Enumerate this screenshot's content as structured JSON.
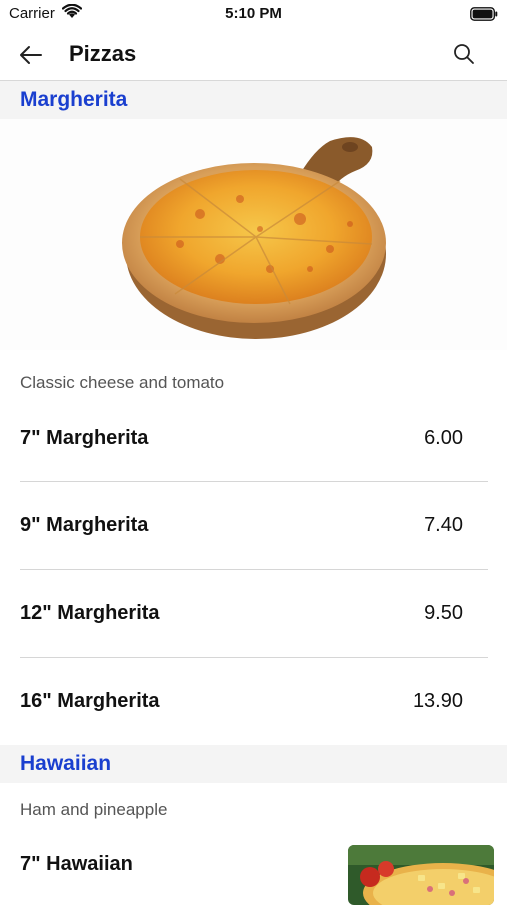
{
  "status": {
    "carrier": "Carrier",
    "time": "5:10 PM"
  },
  "nav": {
    "title": "Pizzas"
  },
  "sections": [
    {
      "title": "Margherita",
      "description": "Classic cheese and tomato",
      "items": [
        {
          "name": "7\" Margherita",
          "price": "6.00"
        },
        {
          "name": "9\" Margherita",
          "price": "7.40"
        },
        {
          "name": "12\" Margherita",
          "price": "9.50"
        },
        {
          "name": "16\" Margherita",
          "price": "13.90"
        }
      ]
    },
    {
      "title": "Hawaiian",
      "description": "Ham and pineapple",
      "items": [
        {
          "name": "7\" Hawaiian"
        }
      ]
    }
  ],
  "colors": {
    "section_title": "#1a3fcf",
    "section_bg": "#f4f4f4"
  },
  "icons": [
    "wifi-icon",
    "battery-icon",
    "back-arrow-icon",
    "search-icon"
  ]
}
